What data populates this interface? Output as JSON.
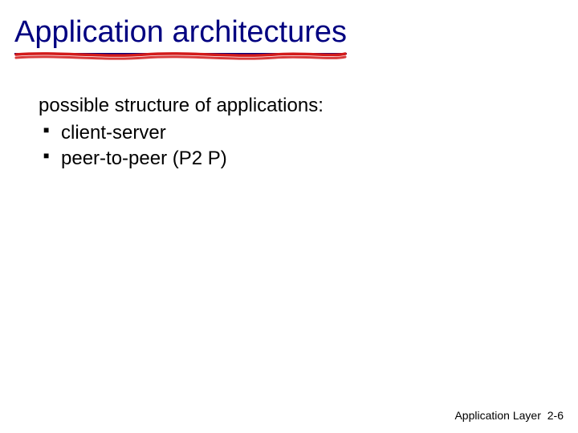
{
  "title": "Application architectures",
  "intro": "possible structure of applications:",
  "bullets": [
    "client-server",
    "peer-to-peer (P2 P)"
  ],
  "footer": {
    "label": "Application Layer",
    "page": "2-6"
  }
}
